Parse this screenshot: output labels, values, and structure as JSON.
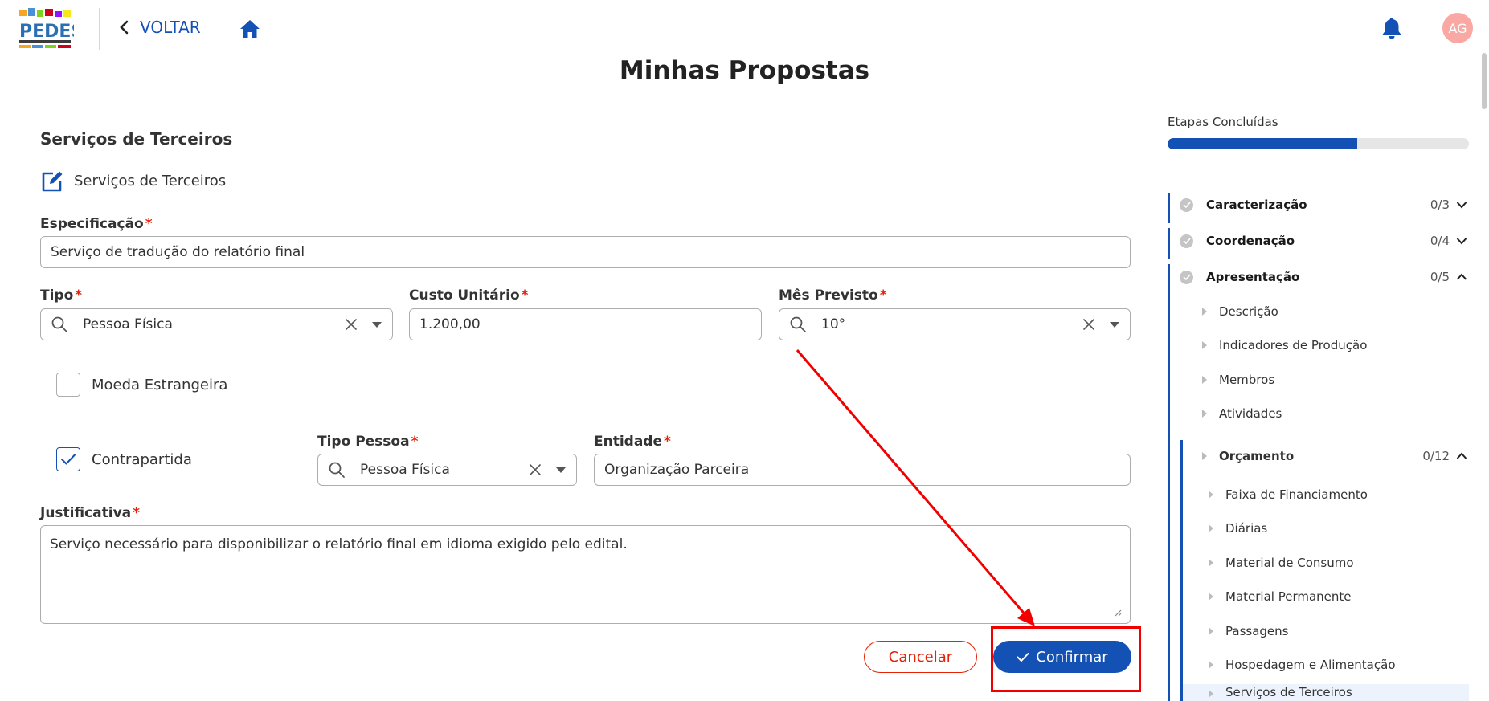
{
  "header": {
    "logo_text": "PEDES",
    "back_label": "VOLTAR",
    "avatar_initials": "AG"
  },
  "page": {
    "title": "Minhas Propostas"
  },
  "form": {
    "section_title": "Serviços de Terceiros",
    "subsection_title": "Serviços de Terceiros",
    "required_mark": "*",
    "especificacao": {
      "label": "Especificação",
      "value": "Serviço de tradução do relatório final"
    },
    "tipo": {
      "label": "Tipo",
      "value": "Pessoa Física"
    },
    "custo_unitario": {
      "label": "Custo Unitário",
      "value": "1.200,00"
    },
    "mes_previsto": {
      "label": "Mês Previsto",
      "value": "10°"
    },
    "moeda_estrangeira": {
      "label": "Moeda Estrangeira",
      "checked": false
    },
    "contrapartida": {
      "label": "Contrapartida",
      "checked": true
    },
    "tipo_pessoa": {
      "label": "Tipo Pessoa",
      "value": "Pessoa Física"
    },
    "entidade": {
      "label": "Entidade",
      "value": "Organização Parceira"
    },
    "justificativa": {
      "label": "Justificativa",
      "value": "Serviço necessário para disponibilizar o relatório final em idioma exigido pelo edital."
    },
    "cancel_label": "Cancelar",
    "confirm_label": "Confirmar"
  },
  "sidebar": {
    "steps_label": "Etapas Concluídas",
    "progress_fraction": 0.63,
    "steps": [
      {
        "name": "Caracterização",
        "count": "0/3",
        "expanded": false
      },
      {
        "name": "Coordenação",
        "count": "0/4",
        "expanded": false
      },
      {
        "name": "Apresentação",
        "count": "0/5",
        "expanded": true
      }
    ],
    "apresentacao_items": [
      "Descrição",
      "Indicadores de Produção",
      "Membros",
      "Atividades"
    ],
    "orcamento": {
      "name": "Orçamento",
      "count": "0/12"
    },
    "orcamento_items": [
      "Faixa de Financiamento",
      "Diárias",
      "Material de Consumo",
      "Material Permanente",
      "Passagens",
      "Hospedagem e Alimentação",
      "Serviços de Terceiros"
    ]
  },
  "colors": {
    "primary": "#1351b4",
    "danger": "#e52207",
    "annotation": "#f20000",
    "avatar": "#f9a8a3"
  }
}
